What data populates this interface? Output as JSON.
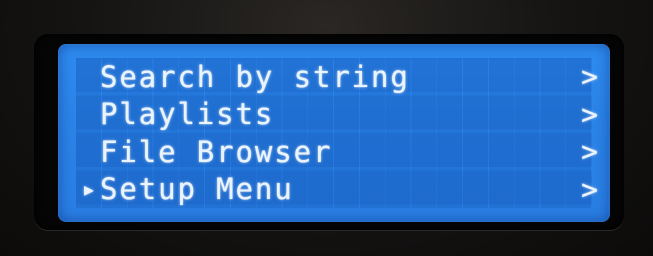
{
  "menu": {
    "items": [
      {
        "label": "Search by string",
        "cursor": "",
        "chevron": ">"
      },
      {
        "label": "Playlists",
        "cursor": "",
        "chevron": ">"
      },
      {
        "label": "File Browser",
        "cursor": "",
        "chevron": ">"
      },
      {
        "label": "Setup Menu",
        "cursor": "▶",
        "chevron": ">",
        "selected": true
      }
    ]
  },
  "colors": {
    "lcd_background": "#2b84e8",
    "text": "#eaf4ff",
    "bezel": "#050505"
  },
  "icons": {
    "cursor": "selection-cursor-icon",
    "chevron": "chevron-right-icon"
  }
}
